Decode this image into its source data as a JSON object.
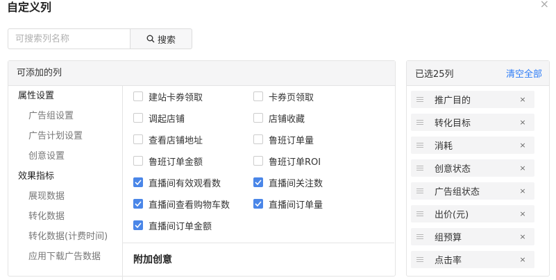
{
  "dialog": {
    "title": "自定义列",
    "close_icon": "×"
  },
  "search": {
    "placeholder": "可搜索列名称",
    "value": "",
    "button_label": "搜索"
  },
  "left_panel": {
    "header": "可添加的列",
    "nav": [
      {
        "label": "属性设置",
        "level": 1
      },
      {
        "label": "广告组设置",
        "level": 2
      },
      {
        "label": "广告计划设置",
        "level": 2
      },
      {
        "label": "创意设置",
        "level": 2
      },
      {
        "label": "效果指标",
        "level": 1
      },
      {
        "label": "展现数据",
        "level": 2
      },
      {
        "label": "转化数据",
        "level": 2
      },
      {
        "label": "转化数据(计费时间)",
        "level": 2
      },
      {
        "label": "应用下载广告数据",
        "level": 2
      }
    ],
    "options": [
      {
        "label": "建站卡券领取",
        "checked": false
      },
      {
        "label": "卡券页领取",
        "checked": false
      },
      {
        "label": "调起店铺",
        "checked": false
      },
      {
        "label": "店铺收藏",
        "checked": false
      },
      {
        "label": "查看店铺地址",
        "checked": false
      },
      {
        "label": "鲁班订单量",
        "checked": false
      },
      {
        "label": "鲁班订单金额",
        "checked": false
      },
      {
        "label": "鲁班订单ROI",
        "checked": false
      },
      {
        "label": "直播间有效观看数",
        "checked": true
      },
      {
        "label": "直播间关注数",
        "checked": true
      },
      {
        "label": "直播间查看购物车数",
        "checked": true
      },
      {
        "label": "直播间订单量",
        "checked": true
      },
      {
        "label": "直播间订单金额",
        "checked": true
      }
    ],
    "section_title": "附加创意"
  },
  "right_panel": {
    "count_label": "已选25列",
    "clear_label": "清空全部",
    "remove_icon": "×",
    "items": [
      "推广目的",
      "转化目标",
      "消耗",
      "创意状态",
      "广告组状态",
      "出价(元)",
      "组预算",
      "点击率"
    ]
  },
  "colors": {
    "accent": "#4a86e8",
    "link": "#2d7cf6"
  }
}
